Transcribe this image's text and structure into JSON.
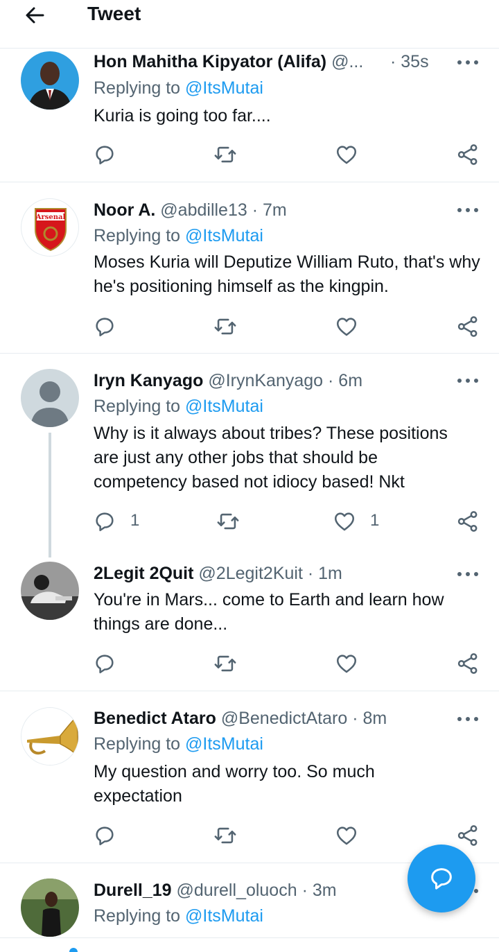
{
  "header": {
    "title": "Tweet"
  },
  "tweets": [
    {
      "name": "Hon Mahitha Kipyator (Alifa)",
      "handle": "@...",
      "time": "· 35s",
      "replying_prefix": "Replying to ",
      "mention": "@ItsMutai",
      "body": "Kuria is going too far....",
      "replies": "",
      "likes": ""
    },
    {
      "name": "Noor A.",
      "handle": "@abdille13",
      "time": "· 7m",
      "replying_prefix": "Replying to ",
      "mention": "@ItsMutai",
      "body": "Moses Kuria will Deputize William Ruto, that's why he's positioning himself as the kingpin.",
      "replies": "",
      "likes": "",
      "avatar_text": "Arsenal"
    },
    {
      "name": "Iryn Kanyago",
      "handle": "@IrynKanyago",
      "time": "· 6m",
      "replying_prefix": "Replying to ",
      "mention": "@ItsMutai",
      "body": "Why is it always about tribes? These positions are just any other jobs that should be competency based not idiocy based! Nkt",
      "replies": "1",
      "likes": "1"
    },
    {
      "name": "2Legit 2Quit",
      "handle": "@2Legit2Kuit",
      "time": "· 1m",
      "body": "You're in Mars... come to Earth and learn how things are done...",
      "replies": "",
      "likes": ""
    },
    {
      "name": "Benedict Ataro",
      "handle": "@BenedictAtaro",
      "time": "· 8m",
      "replying_prefix": "Replying to ",
      "mention": "@ItsMutai",
      "body": "My question and worry too. So much expectation",
      "replies": "",
      "likes": ""
    },
    {
      "name": "Durell_19",
      "handle": "@durell_oluoch",
      "time": "· 3m",
      "replying_prefix": "Replying to ",
      "mention": "@ItsMutai"
    }
  ],
  "icons": {
    "back": "arrow-left-icon",
    "more": "more-dots-icon",
    "reply": "reply-icon",
    "retweet": "retweet-icon",
    "like": "heart-icon",
    "share": "share-icon",
    "compose": "compose-reply-icon"
  },
  "colors": {
    "accent": "#1d9bf0",
    "text": "#0f1419",
    "secondary": "#536471",
    "divider": "#e6ecf0"
  }
}
